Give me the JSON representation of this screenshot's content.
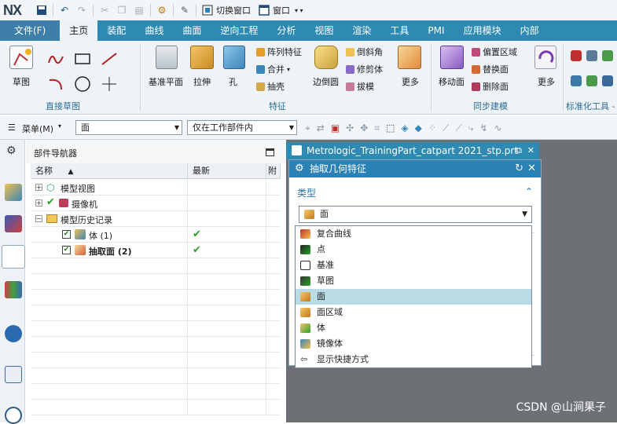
{
  "app": {
    "logo": "NX"
  },
  "quick_access": {
    "switch_window": "切换窗口",
    "window": "窗口"
  },
  "tabs": [
    "文件(F)",
    "主页",
    "装配",
    "曲线",
    "曲面",
    "逆向工程",
    "分析",
    "视图",
    "渲染",
    "工具",
    "PMI",
    "应用模块",
    "内部"
  ],
  "active_tab": "主页",
  "ribbon": {
    "groups": {
      "direct_sketch": "直接草图",
      "feature": "特征",
      "sync_modeling": "同步建模",
      "standardize": "标准化工具 -"
    },
    "sketch": "草图",
    "datum_plane": "基准平面",
    "extrude": "拉伸",
    "hole": "孔",
    "pattern_feature": "阵列特征",
    "unite": "合并",
    "shell": "抽壳",
    "edge_blend": "边倒圆",
    "chamfer": "倒斜角",
    "trim_body": "修剪体",
    "draft": "拔模",
    "more1": "更多",
    "move_face": "移动面",
    "offset_region": "偏置区域",
    "replace_face": "替换面",
    "delete_face": "删除面",
    "more2": "更多"
  },
  "selection_bar": {
    "menu": "菜单(M)",
    "filter": "面",
    "scope": "仅在工作部件内"
  },
  "navigator": {
    "title": "部件导航器",
    "col_name": "名称",
    "col_latest": "最新",
    "col_p": "附",
    "rows": [
      {
        "label": "模型视图",
        "bold": false
      },
      {
        "label": "摄像机",
        "bold": false
      },
      {
        "label": "模型历史记录",
        "bold": false
      },
      {
        "label": "体 (1)",
        "bold": false,
        "latest": "✔"
      },
      {
        "label": "抽取面 (2)",
        "bold": true,
        "latest": "✔"
      }
    ]
  },
  "document": {
    "tab": "Metrologic_TrainingPart_catpart 2021_stp.prt"
  },
  "dialog": {
    "title": "抽取几何特征",
    "section_type": "类型",
    "selected": "面"
  },
  "dropdown": {
    "items": [
      "复合曲线",
      "点",
      "基准",
      "草图",
      "面",
      "面区域",
      "体",
      "镜像体",
      "显示快捷方式"
    ],
    "selected_index": 4
  },
  "watermark": "CSDN @山涧果子",
  "colors": {
    "tab_bar": "#2f8ab3",
    "ribbon": "#eef3f8",
    "dialog_title": "#2a81b5",
    "selected_item": "#b8dbe6"
  }
}
